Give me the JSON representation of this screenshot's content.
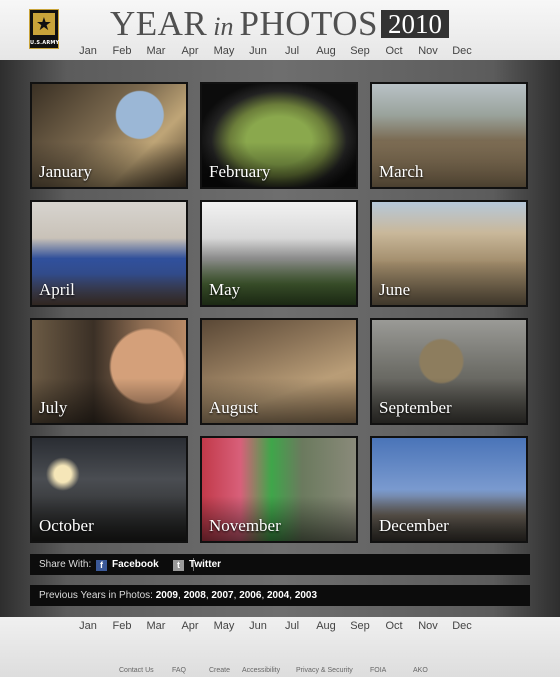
{
  "header": {
    "logo_text": "U.S.ARMY",
    "logo_icon": "star-icon",
    "title_part1": "YEAR",
    "title_part2": "in",
    "title_part3": "PHOTOS",
    "year": "2010"
  },
  "months_nav": [
    "Jan",
    "Feb",
    "Mar",
    "Apr",
    "May",
    "Jun",
    "Jul",
    "Aug",
    "Sep",
    "Oct",
    "Nov",
    "Dec"
  ],
  "tiles": [
    {
      "label": "January"
    },
    {
      "label": "February"
    },
    {
      "label": "March"
    },
    {
      "label": "April"
    },
    {
      "label": "May"
    },
    {
      "label": "June"
    },
    {
      "label": "July"
    },
    {
      "label": "August"
    },
    {
      "label": "September"
    },
    {
      "label": "October"
    },
    {
      "label": "November"
    },
    {
      "label": "December"
    }
  ],
  "share": {
    "label": "Share With:",
    "facebook": "Facebook",
    "twitter": "Twitter",
    "facebook_icon": "facebook-icon",
    "twitter_icon": "twitter-icon"
  },
  "previous": {
    "label": "Previous Years in Photos:",
    "years": [
      "2009",
      "2008",
      "2007",
      "2006",
      "2004",
      "2003"
    ]
  },
  "footer": {
    "links": [
      "Contact Us",
      "FAQ",
      "Create",
      "Accessibility",
      "Privacy & Security",
      "FOIA",
      "AKO"
    ]
  },
  "colors": {
    "badge_bg": "#333333",
    "bar_bg": "#0c0c0c",
    "logo_gold": "#c9a43a",
    "facebook_blue": "#3b5998"
  }
}
